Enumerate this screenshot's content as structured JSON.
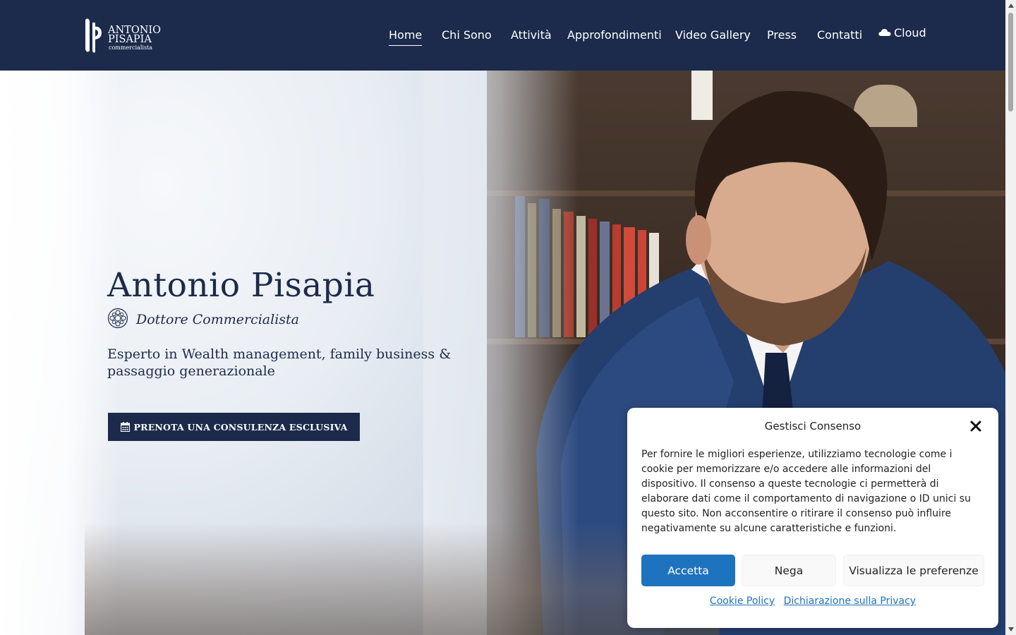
{
  "header": {
    "logo": {
      "line1": "ANTONIO",
      "line2": "PISAPIA",
      "line3": "commercialista"
    },
    "nav": [
      {
        "label": "Home",
        "active": true
      },
      {
        "label": "Chi Sono"
      },
      {
        "label": "Attività"
      },
      {
        "label": "Approfondimenti"
      },
      {
        "label": "Video Gallery"
      },
      {
        "label": "Press"
      },
      {
        "label": "Contatti"
      },
      {
        "label": "Cloud",
        "icon": "cloud-icon"
      }
    ]
  },
  "hero": {
    "title": "Antonio Pisapia",
    "subtitle": "Dottore Commercialista",
    "subtitle_icon": "seal-icon",
    "description": "Esperto in Wealth management, family business & passaggio generazionale",
    "cta_label": "PRENOTA UNA CONSULENZA ESCLUSIVA",
    "cta_icon": "calendar-icon"
  },
  "cookie_modal": {
    "title": "Gestisci Consenso",
    "text": "Per fornire le migliori esperienze, utilizziamo tecnologie come i cookie per memorizzare e/o accedere alle informazioni del dispositivo. Il consenso a queste tecnologie ci permetterà di elaborare dati come il comportamento di navigazione o ID unici su questo sito. Non acconsentire o ritirare il consenso può influire negativamente su alcune caratteristiche e funzioni.",
    "accept_label": "Accetta",
    "deny_label": "Nega",
    "prefs_label": "Visualizza le preferenze",
    "cookie_policy_label": "Cookie Policy",
    "privacy_label": "Dichiarazione sulla Privacy"
  },
  "colors": {
    "navy": "#1c2b4b",
    "accent_blue": "#1e73be",
    "white": "#ffffff"
  }
}
